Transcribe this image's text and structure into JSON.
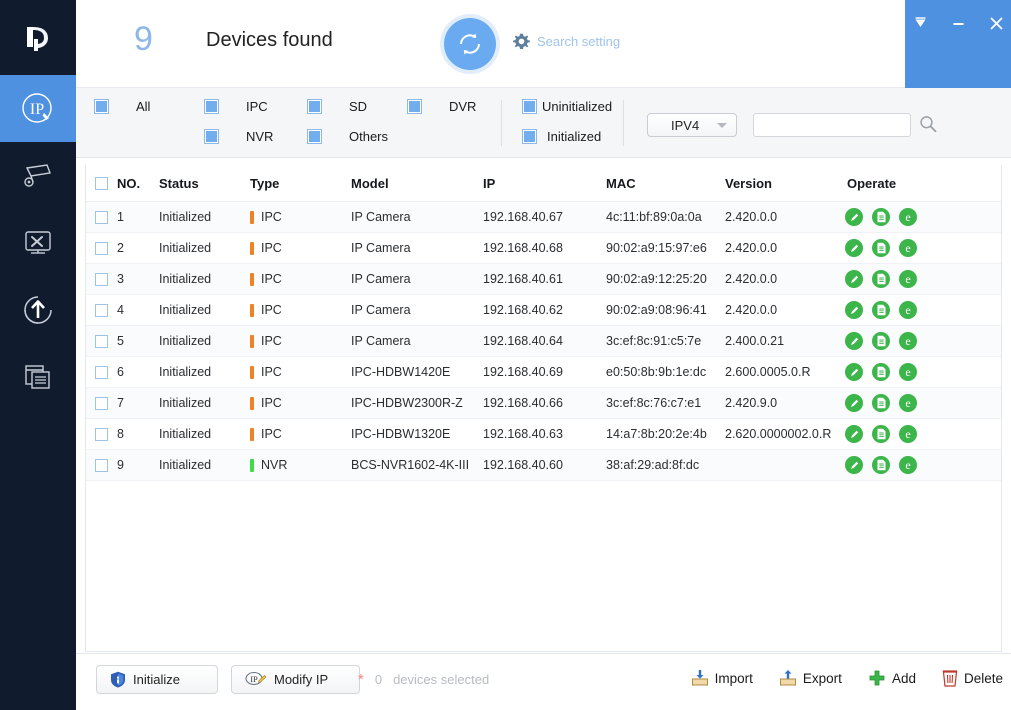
{
  "app": {
    "logo": "dahua-logo",
    "window_controls": [
      {
        "name": "pin-dropdown-icon",
        "glyph": "▼"
      },
      {
        "name": "minimize-icon",
        "glyph": "—"
      },
      {
        "name": "close-icon",
        "glyph": "✕"
      }
    ]
  },
  "sidebar": {
    "items": [
      {
        "key": "device-ip-modify",
        "icon": "ip-edit-icon",
        "active": true
      },
      {
        "key": "device-config",
        "icon": "camera-settings-icon",
        "active": false
      },
      {
        "key": "device-tools",
        "icon": "monitor-tools-icon",
        "active": false
      },
      {
        "key": "device-upgrade",
        "icon": "upload-upgrade-icon",
        "active": false
      },
      {
        "key": "device-logs",
        "icon": "windows-stack-icon",
        "active": false
      }
    ]
  },
  "header": {
    "count": "9",
    "count_label": "Devices found",
    "refresh_icon": "refresh-circular-arrows-icon",
    "search_setting_icon": "gear-icon",
    "search_setting_label": "Search setting",
    "accent_blue": "#4e91e0",
    "count_color": "#8cb7e8"
  },
  "filters": {
    "checkboxes": [
      {
        "key": "all",
        "label": "All",
        "checked": true
      },
      {
        "key": "ipc",
        "label": "IPC",
        "checked": true
      },
      {
        "key": "nvr",
        "label": "NVR",
        "checked": true
      },
      {
        "key": "sd",
        "label": "SD",
        "checked": true
      },
      {
        "key": "others",
        "label": "Others",
        "checked": true
      },
      {
        "key": "dvr",
        "label": "DVR",
        "checked": true
      },
      {
        "key": "uninitialized",
        "label": "Uninitialized",
        "checked": true
      },
      {
        "key": "initialized",
        "label": "Initialized",
        "checked": true
      }
    ],
    "protocol_selected": "IPV4",
    "protocol_options": [
      "IPV4",
      "IPV6"
    ],
    "search_value": "",
    "search_placeholder": "",
    "search_icon": "magnifier-icon"
  },
  "table": {
    "columns": [
      "NO.",
      "Status",
      "Type",
      "Model",
      "IP",
      "MAC",
      "Version",
      "Operate"
    ],
    "type_colors": {
      "IPC": "#ef8126",
      "NVR": "#3ddc48"
    },
    "operate_icons": [
      {
        "name": "edit-pencil-icon",
        "glyph": "edit"
      },
      {
        "name": "details-document-icon",
        "glyph": "doc"
      },
      {
        "name": "web-browser-icon",
        "glyph": "e"
      }
    ],
    "rows": [
      {
        "no": "1",
        "status": "Initialized",
        "type": "IPC",
        "model": "IP Camera",
        "ip": "192.168.40.67",
        "mac": "4c:11:bf:89:0a:0a",
        "version": "2.420.0.0",
        "checked": false
      },
      {
        "no": "2",
        "status": "Initialized",
        "type": "IPC",
        "model": "IP Camera",
        "ip": "192.168.40.68",
        "mac": "90:02:a9:15:97:e6",
        "version": "2.420.0.0",
        "checked": false
      },
      {
        "no": "3",
        "status": "Initialized",
        "type": "IPC",
        "model": "IP Camera",
        "ip": "192.168.40.61",
        "mac": "90:02:a9:12:25:20",
        "version": "2.420.0.0",
        "checked": false
      },
      {
        "no": "4",
        "status": "Initialized",
        "type": "IPC",
        "model": "IP Camera",
        "ip": "192.168.40.62",
        "mac": "90:02:a9:08:96:41",
        "version": "2.420.0.0",
        "checked": false
      },
      {
        "no": "5",
        "status": "Initialized",
        "type": "IPC",
        "model": "IP Camera",
        "ip": "192.168.40.64",
        "mac": "3c:ef:8c:91:c5:7e",
        "version": "2.400.0.21",
        "checked": false
      },
      {
        "no": "6",
        "status": "Initialized",
        "type": "IPC",
        "model": "IPC-HDBW1420E",
        "ip": "192.168.40.69",
        "mac": "e0:50:8b:9b:1e:dc",
        "version": "2.600.0005.0.R",
        "checked": false
      },
      {
        "no": "7",
        "status": "Initialized",
        "type": "IPC",
        "model": "IPC-HDBW2300R-Z",
        "ip": "192.168.40.66",
        "mac": "3c:ef:8c:76:c7:e1",
        "version": "2.420.9.0",
        "checked": false
      },
      {
        "no": "8",
        "status": "Initialized",
        "type": "IPC",
        "model": "IPC-HDBW1320E",
        "ip": "192.168.40.63",
        "mac": "14:a7:8b:20:2e:4b",
        "version": "2.620.0000002.0.R",
        "checked": false
      },
      {
        "no": "9",
        "status": "Initialized",
        "type": "NVR",
        "model": "BCS-NVR1602-4K-III",
        "ip": "192.168.40.60",
        "mac": "38:af:29:ad:8f:dc",
        "version": "",
        "checked": false
      }
    ]
  },
  "footer": {
    "initialize_label": "Initialize",
    "initialize_icon": "shield-icon",
    "modify_ip_label": "Modify IP",
    "modify_ip_icon": "ip-pencil-icon",
    "selected_star": "*",
    "selected_count": "0",
    "selected_text": "devices selected",
    "actions": [
      {
        "key": "import",
        "label": "Import",
        "icon": "import-tray-down-icon"
      },
      {
        "key": "export",
        "label": "Export",
        "icon": "export-tray-up-icon"
      },
      {
        "key": "add",
        "label": "Add",
        "icon": "plus-icon"
      },
      {
        "key": "delete",
        "label": "Delete",
        "icon": "trash-icon"
      }
    ]
  }
}
